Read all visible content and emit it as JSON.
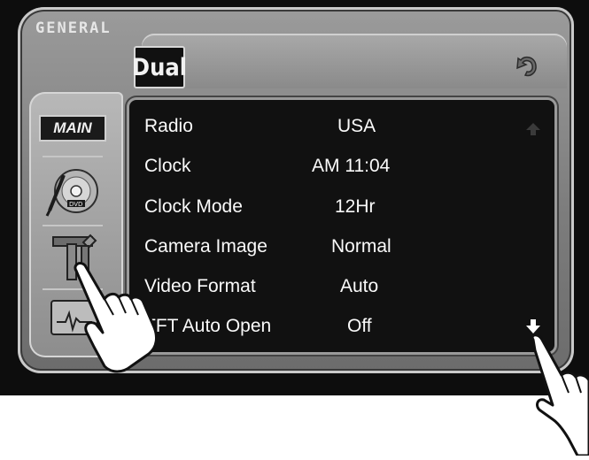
{
  "header": {
    "title": "GENERAL",
    "brand": "Dual"
  },
  "sidebar": {
    "items": [
      {
        "label": "MAIN",
        "icon": "main-tab"
      },
      {
        "icon": "dvd-icon"
      },
      {
        "icon": "tools-icon"
      },
      {
        "icon": "monitor-icon"
      }
    ]
  },
  "settings": [
    {
      "label": "Radio",
      "value": "USA"
    },
    {
      "label": "Clock",
      "value": "AM 11:04"
    },
    {
      "label": "Clock Mode",
      "value": "12Hr"
    },
    {
      "label": "Camera Image",
      "value": "Normal"
    },
    {
      "label": "Video Format",
      "value": "Auto"
    },
    {
      "label": "TFT Auto Open",
      "value": "Off"
    }
  ],
  "colors": {
    "screen": "#0d0d0d",
    "bezel": "#8a8a8a",
    "panel": "#111111",
    "text": "#fafafa"
  }
}
